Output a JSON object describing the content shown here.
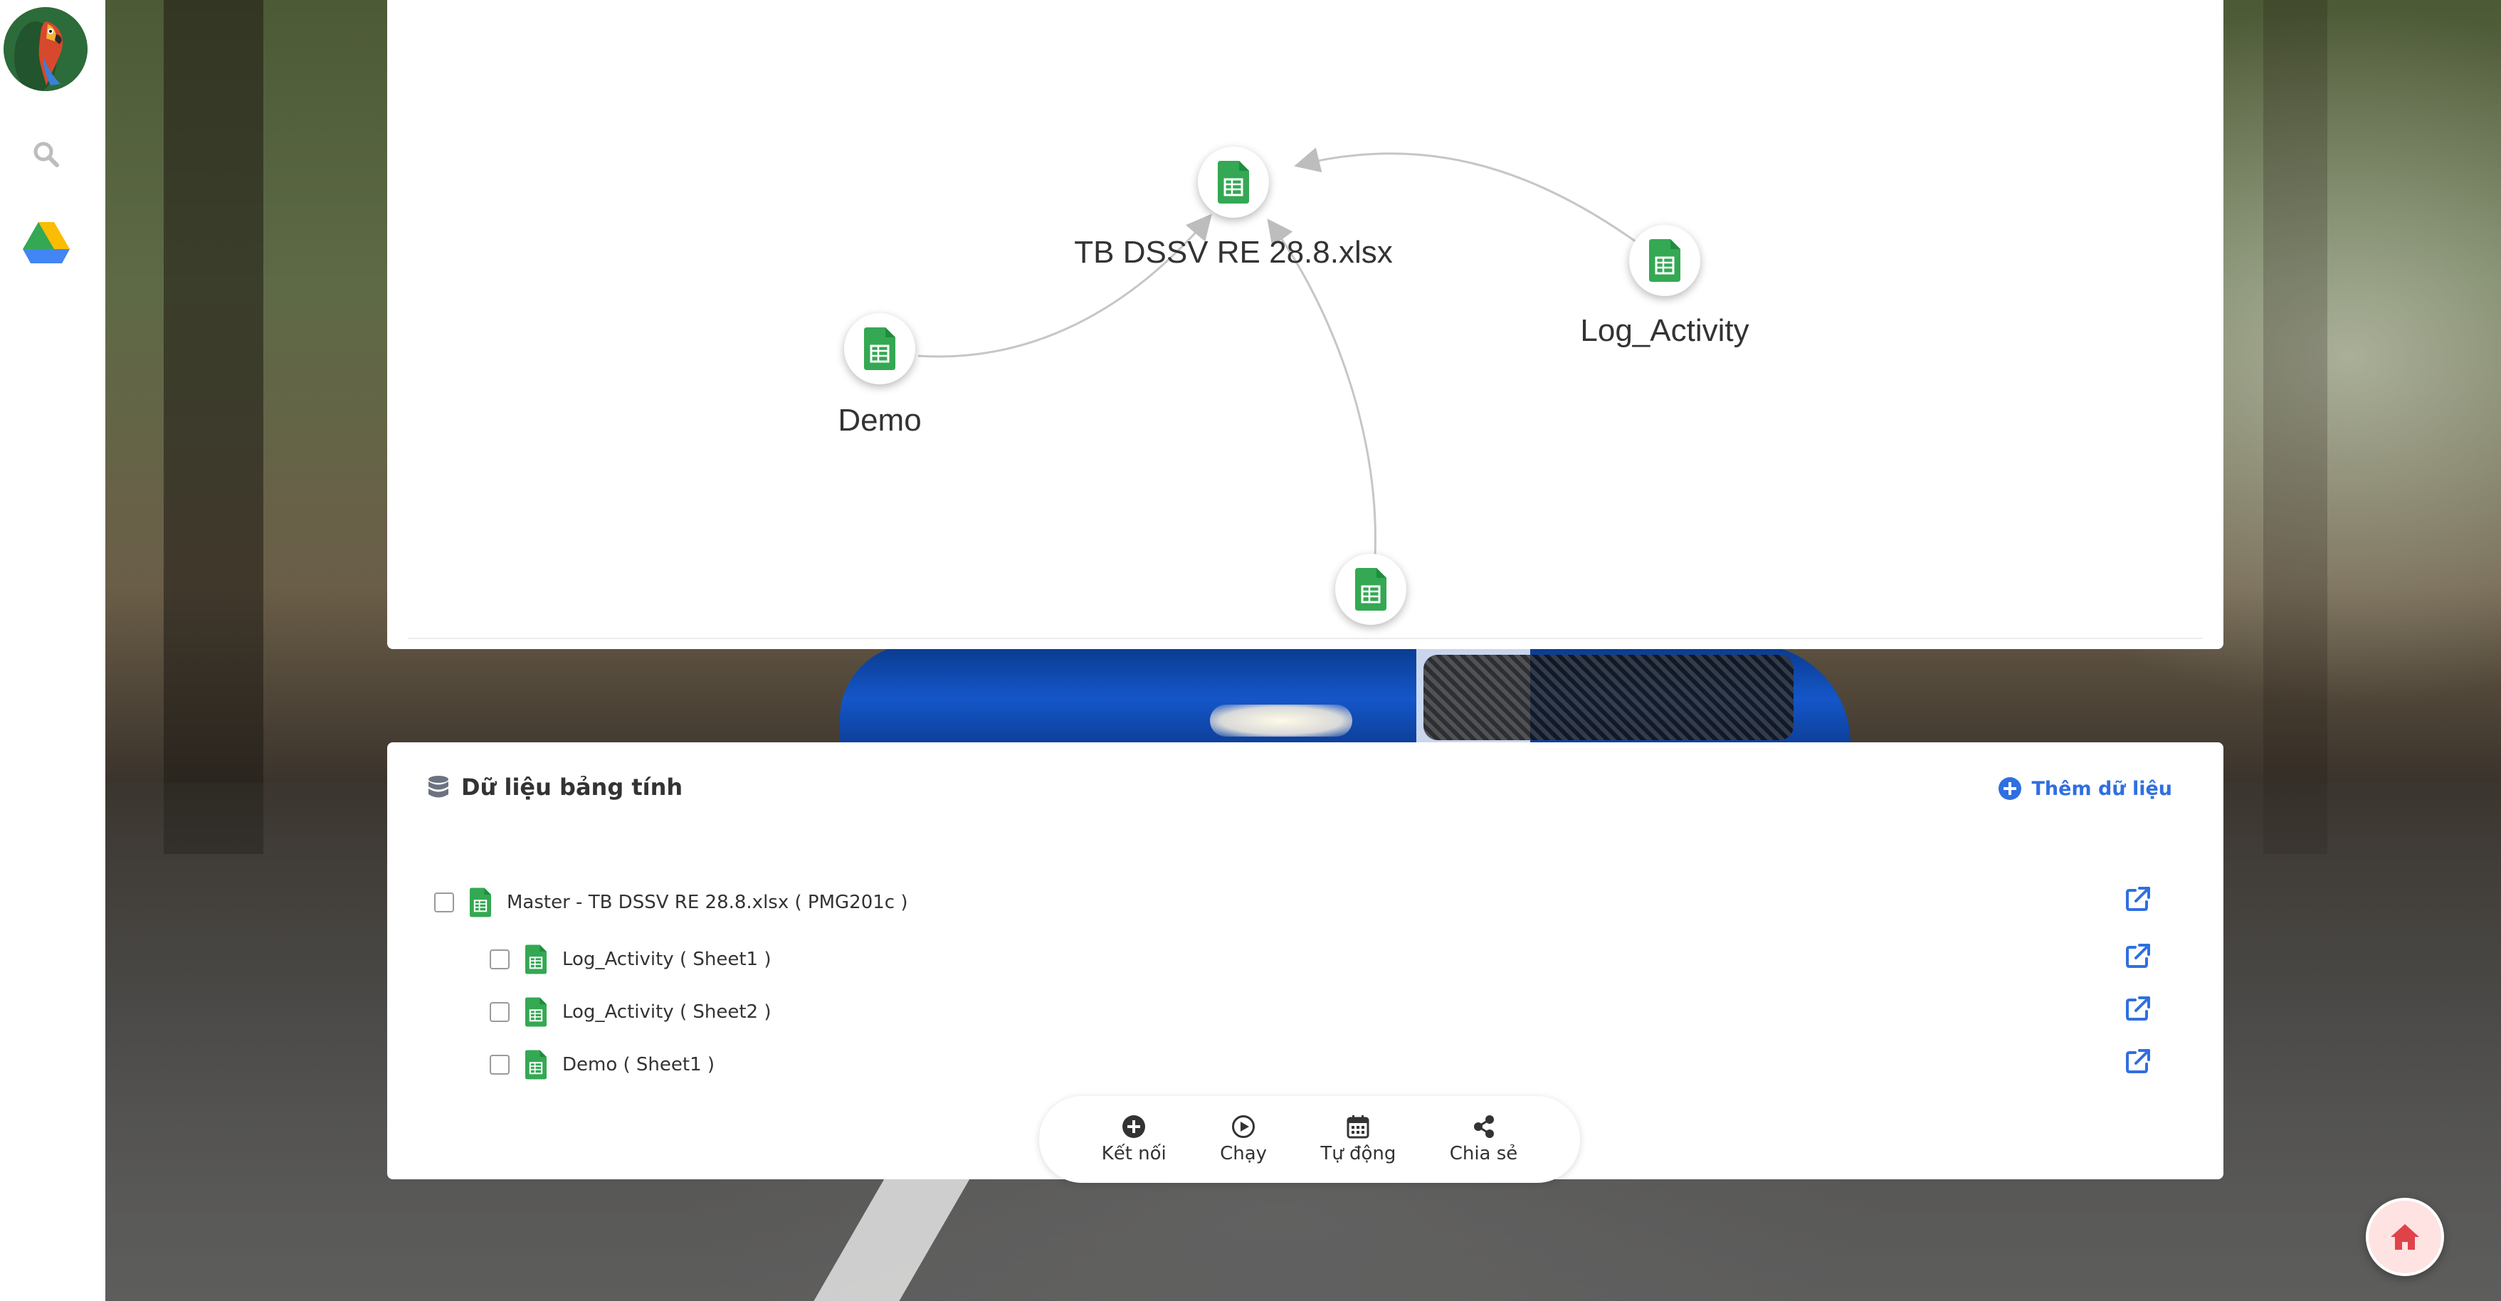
{
  "graph": {
    "nodes": [
      {
        "label": "TB DSSV RE 28.8.xlsx",
        "icon": "sheets-icon"
      },
      {
        "label": "Log_Activity",
        "icon": "sheets-icon"
      },
      {
        "label": "Demo",
        "icon": "sheets-icon"
      },
      {
        "label": "",
        "icon": "sheets-icon"
      }
    ]
  },
  "data_panel": {
    "title": "Dữ liệu bảng tính",
    "add_label": "Thêm dữ liệu",
    "rows": [
      {
        "label": "Master - TB DSSV RE 28.8.xlsx ( PMG201c )"
      },
      {
        "label": "Log_Activity ( Sheet1 )"
      },
      {
        "label": "Log_Activity ( Sheet2 )"
      },
      {
        "label": "Demo ( Sheet1 )"
      }
    ]
  },
  "toolbar": {
    "connect": "Kết nối",
    "run": "Chạy",
    "auto": "Tự động",
    "share": "Chia sẻ"
  },
  "colors": {
    "sheets_green": "#34a853",
    "accent_blue": "#2f6fe0",
    "home_red": "#e0424a"
  }
}
